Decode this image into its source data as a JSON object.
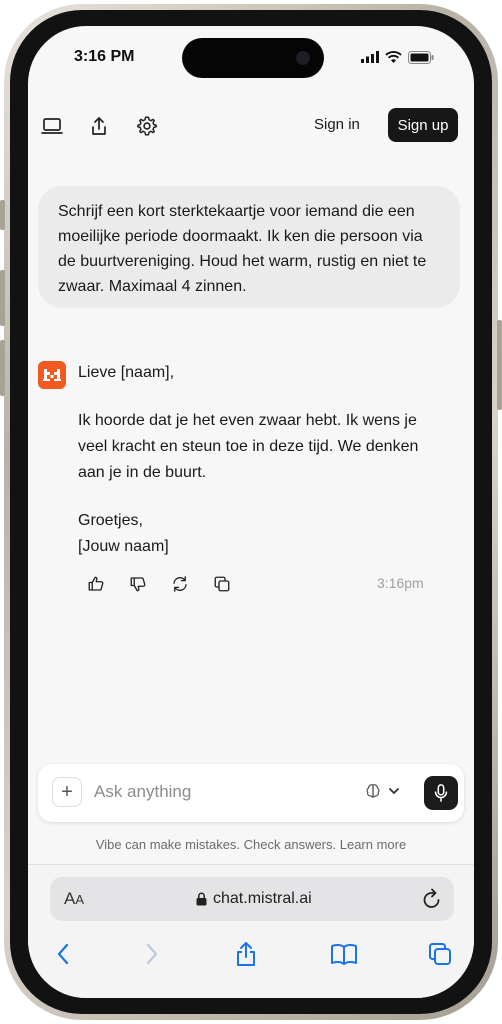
{
  "status_bar": {
    "time": "3:16 PM"
  },
  "topbar": {
    "sign_in_label": "Sign in",
    "sign_up_label": "Sign up"
  },
  "conversation": {
    "user_message": "Schrijf een kort sterktekaartje voor iemand die een moeilijke periode doormaakt. Ik ken die persoon via de buurtvereniging. Houd het warm, rustig en niet te zwaar. Maximaal 4 zinnen.",
    "assistant_reply": {
      "greeting": "Lieve [naam],",
      "body": "Ik hoorde dat je het even zwaar hebt. Ik wens je veel kracht en steun toe in deze tijd. We denken aan je in de buurt.",
      "closing": "Groetjes,\n[Jouw naam]"
    },
    "message_time": "3:16pm"
  },
  "composer": {
    "placeholder": "Ask anything",
    "plus_label": "+"
  },
  "disclaimer": "Vibe can make mistakes. Check answers. Learn more",
  "browser": {
    "aa_label": "A",
    "aa_small": "A",
    "url": "chat.mistral.ai"
  },
  "icons": {
    "brand_color": "#f25a22",
    "sign_up_bg": "#171717"
  }
}
